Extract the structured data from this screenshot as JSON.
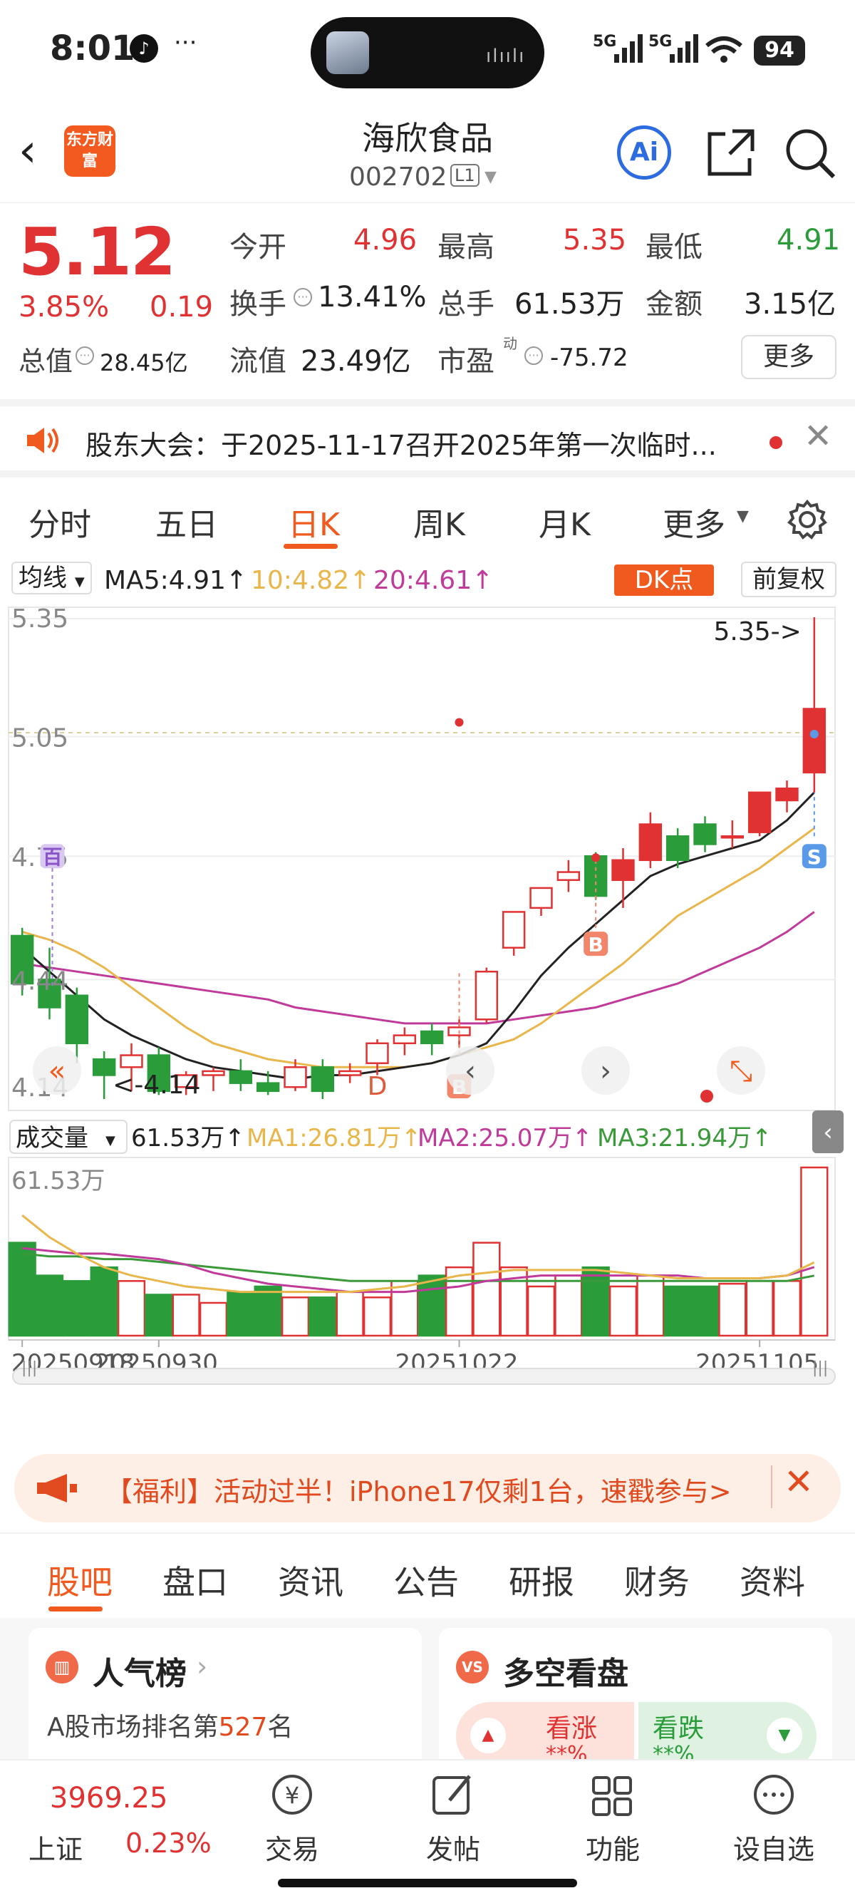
{
  "status": {
    "time": "8:01",
    "signal1": "5G",
    "signal2": "5G",
    "battery": "94"
  },
  "header": {
    "logo": "东方财富",
    "title": "海欣食品",
    "code": "002702",
    "code_tag": "L1",
    "ai_label": "Ai"
  },
  "quote": {
    "price": "5.12",
    "change_pct": "3.85%",
    "change": "0.19",
    "open_label": "今开",
    "open": "4.96",
    "high_label": "最高",
    "high": "5.35",
    "low_label": "最低",
    "low": "4.91",
    "turnover_label": "换手",
    "turnover": "13.41%",
    "volume_label": "总手",
    "volume": "61.53万",
    "amount_label": "金额",
    "amount": "3.15亿",
    "mktcap_label": "总值",
    "mktcap": "28.45亿",
    "float_label": "流值",
    "float": "23.49亿",
    "pe_label": "市盈",
    "pe_sup": "动",
    "pe": "-75.72",
    "more": "更多"
  },
  "notice": {
    "text": "股东大会：于2025-11-17召开2025年第一次临时..."
  },
  "ktabs": [
    "分时",
    "五日",
    "日K",
    "周K",
    "月K",
    "更多"
  ],
  "ma_bar": {
    "selector": "均线",
    "ma5": "MA5:4.91↑",
    "ma10": "10:4.82↑",
    "ma20": "20:4.61↑",
    "dk": "DK点",
    "adjust": "前复权"
  },
  "colors": {
    "up": "#e03232",
    "down": "#2a9d3a",
    "ma5": "#222222",
    "ma10": "#e8b64a",
    "ma20": "#c03a9a",
    "accent": "#f05a1e"
  },
  "chart_data": {
    "type": "candlestick",
    "price_axis_labels": [
      "5.35",
      "5.05",
      "4.75",
      "4.44",
      "4.14"
    ],
    "ylim": [
      4.14,
      5.35
    ],
    "max_marker": "5.35->",
    "min_marker": "<-4.14",
    "marker_labels": {
      "hundred": "百",
      "d": "D",
      "b1": "B",
      "b2": "B",
      "s": "S"
    },
    "candles": [
      {
        "o": 4.55,
        "h": 4.57,
        "l": 4.4,
        "c": 4.43
      },
      {
        "o": 4.44,
        "h": 4.52,
        "l": 4.34,
        "c": 4.37
      },
      {
        "o": 4.4,
        "h": 4.42,
        "l": 4.23,
        "c": 4.28
      },
      {
        "o": 4.24,
        "h": 4.26,
        "l": 4.14,
        "c": 4.2
      },
      {
        "o": 4.22,
        "h": 4.28,
        "l": 4.16,
        "c": 4.25
      },
      {
        "o": 4.25,
        "h": 4.27,
        "l": 4.15,
        "c": 4.16
      },
      {
        "o": 4.17,
        "h": 4.21,
        "l": 4.15,
        "c": 4.2
      },
      {
        "o": 4.2,
        "h": 4.22,
        "l": 4.16,
        "c": 4.21
      },
      {
        "o": 4.21,
        "h": 4.24,
        "l": 4.16,
        "c": 4.18
      },
      {
        "o": 4.18,
        "h": 4.21,
        "l": 4.15,
        "c": 4.16
      },
      {
        "o": 4.17,
        "h": 4.24,
        "l": 4.16,
        "c": 4.22
      },
      {
        "o": 4.22,
        "h": 4.24,
        "l": 4.14,
        "c": 4.16
      },
      {
        "o": 4.2,
        "h": 4.23,
        "l": 4.18,
        "c": 4.21
      },
      {
        "o": 4.23,
        "h": 4.29,
        "l": 4.2,
        "c": 4.28
      },
      {
        "o": 4.28,
        "h": 4.32,
        "l": 4.25,
        "c": 4.3
      },
      {
        "o": 4.31,
        "h": 4.33,
        "l": 4.25,
        "c": 4.28
      },
      {
        "o": 4.3,
        "h": 4.34,
        "l": 4.27,
        "c": 4.32
      },
      {
        "o": 4.34,
        "h": 4.47,
        "l": 4.33,
        "c": 4.46
      },
      {
        "o": 4.52,
        "h": 4.61,
        "l": 4.5,
        "c": 4.61
      },
      {
        "o": 4.62,
        "h": 4.67,
        "l": 4.6,
        "c": 4.67
      },
      {
        "o": 4.69,
        "h": 4.74,
        "l": 4.66,
        "c": 4.71
      },
      {
        "o": 4.75,
        "h": 4.76,
        "l": 4.64,
        "c": 4.65
      },
      {
        "o": 4.69,
        "h": 4.77,
        "l": 4.62,
        "c": 4.74
      },
      {
        "o": 4.74,
        "h": 4.86,
        "l": 4.72,
        "c": 4.83
      },
      {
        "o": 4.8,
        "h": 4.82,
        "l": 4.72,
        "c": 4.74
      },
      {
        "o": 4.83,
        "h": 4.85,
        "l": 4.76,
        "c": 4.78
      },
      {
        "o": 4.8,
        "h": 4.84,
        "l": 4.77,
        "c": 4.8
      },
      {
        "o": 4.81,
        "h": 4.91,
        "l": 4.8,
        "c": 4.91
      },
      {
        "o": 4.89,
        "h": 4.94,
        "l": 4.86,
        "c": 4.92
      },
      {
        "o": 4.96,
        "h": 5.35,
        "l": 4.91,
        "c": 5.12
      }
    ],
    "ma5": [
      4.52,
      4.46,
      4.4,
      4.34,
      4.3,
      4.27,
      4.24,
      4.22,
      4.21,
      4.2,
      4.19,
      4.2,
      4.2,
      4.21,
      4.22,
      4.23,
      4.25,
      4.28,
      4.36,
      4.45,
      4.52,
      4.58,
      4.64,
      4.7,
      4.73,
      4.75,
      4.77,
      4.79,
      4.84,
      4.91
    ],
    "ma10": [
      4.56,
      4.54,
      4.51,
      4.47,
      4.42,
      4.37,
      4.32,
      4.28,
      4.26,
      4.24,
      4.23,
      4.22,
      4.22,
      4.22,
      4.22,
      4.23,
      4.25,
      4.27,
      4.29,
      4.33,
      4.38,
      4.43,
      4.48,
      4.54,
      4.6,
      4.64,
      4.68,
      4.72,
      4.77,
      4.82
    ],
    "ma20": [
      4.48,
      4.47,
      4.46,
      4.45,
      4.44,
      4.43,
      4.42,
      4.41,
      4.4,
      4.39,
      4.37,
      4.36,
      4.35,
      4.34,
      4.33,
      4.33,
      4.33,
      4.33,
      4.34,
      4.35,
      4.36,
      4.37,
      4.39,
      4.41,
      4.43,
      4.46,
      4.49,
      4.52,
      4.56,
      4.61
    ],
    "volume_bar": {
      "selector": "成交量",
      "value": "61.53万↑",
      "ma1": "MA1:26.81万↑",
      "ma2": "MA2:25.07万↑",
      "ma3": "MA3:21.94万↑"
    },
    "volume_axis_label": "61.53万",
    "volumes": [
      34,
      22,
      20,
      25,
      20,
      15,
      15,
      12,
      16,
      18,
      14,
      14,
      16,
      14,
      20,
      22,
      25,
      34,
      25,
      18,
      22,
      25,
      18,
      22,
      18,
      18,
      19,
      20,
      20,
      61.53
    ],
    "vol_ma1": [
      44,
      36,
      30,
      25,
      22,
      20,
      18,
      17,
      16,
      16,
      16,
      16,
      16,
      17,
      18,
      20,
      22,
      23,
      24,
      24,
      24,
      24,
      23,
      22,
      21,
      21,
      21,
      21,
      22,
      26.81
    ],
    "vol_ma2": [
      32,
      31,
      30,
      30,
      29,
      28,
      26,
      23,
      21,
      19,
      18,
      17,
      16,
      16,
      16,
      17,
      18,
      20,
      21,
      22,
      22,
      22,
      22,
      22,
      22,
      21,
      21,
      21,
      22,
      25.07
    ],
    "vol_ma3": [
      30,
      29,
      29,
      28,
      28,
      27,
      26,
      25,
      24,
      23,
      22,
      21,
      20,
      20,
      20,
      20,
      20,
      20,
      20,
      20,
      20,
      20,
      20,
      20,
      20,
      20,
      20,
      20,
      20,
      21.94
    ],
    "x_labels": [
      "20250918",
      "20250930",
      "20251022",
      "20251105"
    ]
  },
  "promo": {
    "text": "【福利】活动过半！iPhone17仅剩1台，速戳参与>"
  },
  "btabs": [
    "股吧",
    "盘口",
    "资讯",
    "公告",
    "研报",
    "财务",
    "资料"
  ],
  "cards": {
    "popular_title": "人气榜",
    "popular_rank_prefix": "A股市场排名第",
    "popular_rank": "527",
    "popular_rank_suffix": "名",
    "vs_title": "多空看盘",
    "bull": "看涨",
    "bear": "看跌",
    "bull_pct": "**%",
    "bear_pct": "**%"
  },
  "index": {
    "value": "3969.25",
    "name": "上证",
    "change": "0.23%"
  },
  "tabbar": [
    "交易",
    "发帖",
    "功能",
    "设自选"
  ]
}
